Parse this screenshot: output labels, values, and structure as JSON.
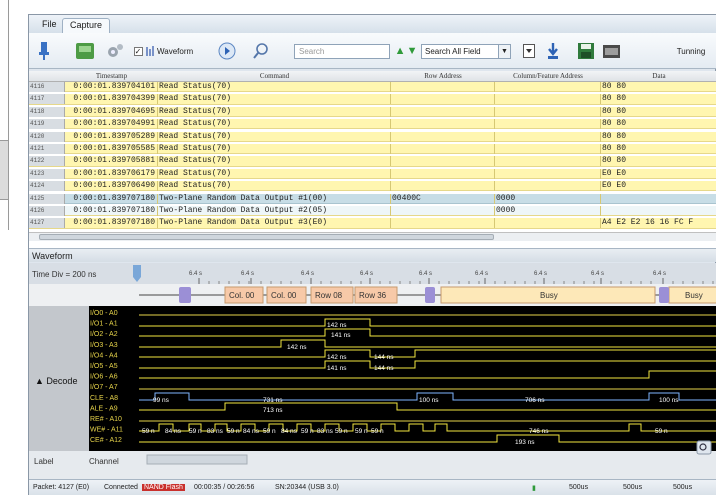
{
  "menu": {
    "tabs": [
      "File",
      "Capture"
    ]
  },
  "toolbar": {
    "waveform_label": "Waveform",
    "search_placeholder": "Search",
    "field_select": "Search All Field",
    "status": "Tunning"
  },
  "table": {
    "headers": [
      "Timestamp",
      "Command",
      "Row Address",
      "Column/Feature Address",
      "Data"
    ],
    "rows": [
      {
        "idx": "4116",
        "ts": "0:00:01.839704101",
        "cmd": "Read Status(70)",
        "ra": "",
        "ca": "",
        "dt": "80 80"
      },
      {
        "idx": "4117",
        "ts": "0:00:01.839704399",
        "cmd": "Read Status(70)",
        "ra": "",
        "ca": "",
        "dt": "80 80"
      },
      {
        "idx": "4118",
        "ts": "0:00:01.839704695",
        "cmd": "Read Status(70)",
        "ra": "",
        "ca": "",
        "dt": "80 80"
      },
      {
        "idx": "4119",
        "ts": "0:00:01.839704991",
        "cmd": "Read Status(70)",
        "ra": "",
        "ca": "",
        "dt": "80 80"
      },
      {
        "idx": "4120",
        "ts": "0:00:01.839705289",
        "cmd": "Read Status(70)",
        "ra": "",
        "ca": "",
        "dt": "80 80"
      },
      {
        "idx": "4121",
        "ts": "0:00:01.839705585",
        "cmd": "Read Status(70)",
        "ra": "",
        "ca": "",
        "dt": "80 80"
      },
      {
        "idx": "4122",
        "ts": "0:00:01.839705881",
        "cmd": "Read Status(70)",
        "ra": "",
        "ca": "",
        "dt": "80 80"
      },
      {
        "idx": "4123",
        "ts": "0:00:01.839706179",
        "cmd": "Read Status(70)",
        "ra": "",
        "ca": "",
        "dt": "E0 E0"
      },
      {
        "idx": "4124",
        "ts": "0:00:01.839706490",
        "cmd": "Read Status(70)",
        "ra": "",
        "ca": "",
        "dt": "E0 E0"
      },
      {
        "idx": "4125",
        "ts": "0:00:01.839707180",
        "cmd": "Two-Plane Random Data Output #1(00)",
        "ra": "00400C",
        "ca": "0000",
        "dt": ""
      },
      {
        "idx": "4126",
        "ts": "0:00:01.839707180",
        "cmd": "Two-Plane Random Data Output #2(05)",
        "ra": "",
        "ca": "0000",
        "dt": ""
      },
      {
        "idx": "4127",
        "ts": "0:00:01.839707180",
        "cmd": "Two-Plane Random Data Output #3(E0)",
        "ra": "",
        "ca": "",
        "dt": "A4 E2 E2 16 16 FC F"
      }
    ]
  },
  "waveform": {
    "title": "Waveform",
    "time_div": "Time Div = 200 ns",
    "ruler_ticks": [
      "6.4 s",
      "6.4 s",
      "6.4 s",
      "6.4 s",
      "6.4 s",
      "6.4 s",
      "6.4 s",
      "6.4 s",
      "6.4 s"
    ],
    "decode_label": "Decode",
    "segments": [
      "Col. 00",
      "Col. 00",
      "Row 08",
      "Row 36",
      "Busy",
      "Busy"
    ],
    "channels": [
      "I/O0 - A0",
      "I/O1 - A1",
      "I/O2 - A2",
      "I/O3 - A3",
      "I/O4 - A4",
      "I/O5 - A5",
      "I/O6 - A6",
      "I/O7 - A7",
      "CLE - A8",
      "ALE - A9",
      "RE# - A10",
      "WE# - A11",
      "CE# - A12"
    ],
    "measures": [
      "142 ns",
      "141 ns",
      "142 ns",
      "142 ns",
      "144 ns",
      "141 ns",
      "144 ns",
      "99 ns",
      "731 ns",
      "100 ns",
      "706 ns",
      "100 ns",
      "713 ns",
      "59 n",
      "84 ns",
      "59 n",
      "83 ns",
      "59 n",
      "84 ns",
      "59 n",
      "84 ns",
      "59 n",
      "83 ns",
      "59 n",
      "59 n",
      "59 n",
      "746 ns",
      "59 n",
      "193 ns"
    ],
    "footer_label": "Label",
    "footer_channel": "Channel"
  },
  "status": {
    "packet": "Packet: 4127 (E0)",
    "connected": "Connected",
    "device": "NAND Flash",
    "time": "00:00:35 / 00:26:56",
    "sn": "SN:20344 (USB 3.0)",
    "rate1": "500us",
    "rate2": "500us",
    "rate3": "500us"
  },
  "colors": {
    "segment": "#f7c9a8",
    "busy": "#fde8b8",
    "marker": "#9b8fd6",
    "trace": "#f2e640",
    "trace_blue": "#7fb6ff",
    "bg_wave": "#000000"
  }
}
